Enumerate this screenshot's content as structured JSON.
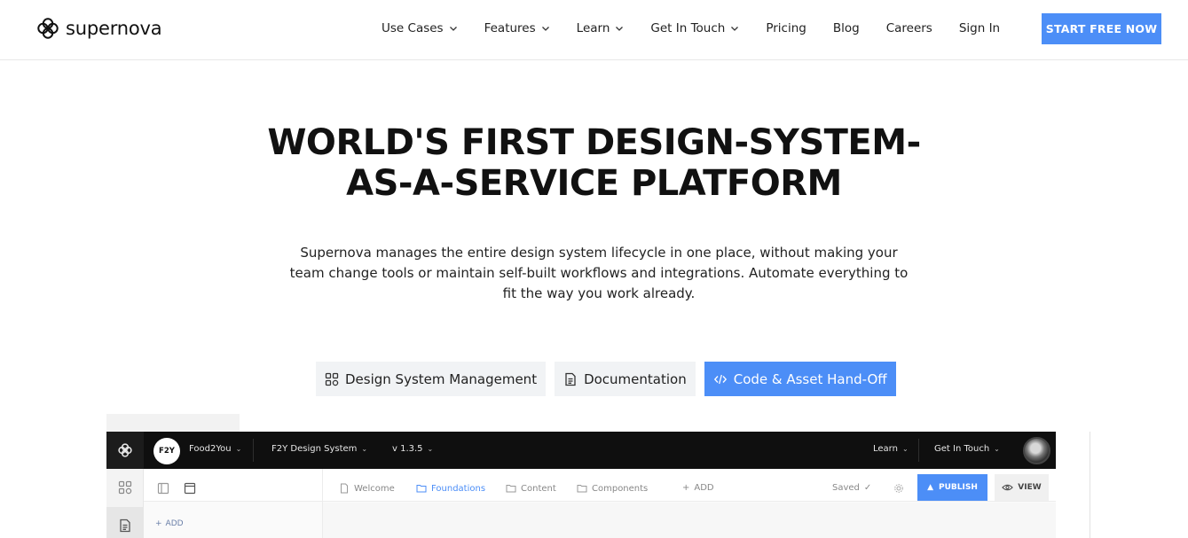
{
  "brand": {
    "name": "supernova",
    "accent": "#4c8ef7"
  },
  "nav": {
    "items": [
      {
        "label": "Use Cases",
        "dropdown": true
      },
      {
        "label": "Features",
        "dropdown": true
      },
      {
        "label": "Learn",
        "dropdown": true
      },
      {
        "label": "Get In Touch",
        "dropdown": true
      },
      {
        "label": "Pricing",
        "dropdown": false
      },
      {
        "label": "Blog",
        "dropdown": false
      },
      {
        "label": "Careers",
        "dropdown": false
      },
      {
        "label": "Sign In",
        "dropdown": false
      }
    ],
    "cta": "START FREE NOW"
  },
  "hero": {
    "title_line1": "WORLD'S FIRST DESIGN-SYSTEM-",
    "title_line2": "AS-A-SERVICE PLATFORM",
    "subtitle": "Supernova manages the entire design system lifecycle in one place, without making your team change tools or maintain self-built workflows and integrations. Automate everything to fit the way you work already."
  },
  "tabs": [
    {
      "label": "Design System Management",
      "icon": "grid-icon",
      "active": false
    },
    {
      "label": "Documentation",
      "icon": "document-icon",
      "active": false
    },
    {
      "label": "Code & Asset Hand-Off",
      "icon": "code-icon",
      "active": true
    }
  ],
  "app_preview": {
    "workspace_badge": "F2Y",
    "workspace": "Food2You",
    "design_system": "F2Y Design System",
    "version": "v 1.3.5",
    "top_right": {
      "learn": "Learn",
      "get_in_touch": "Get In Touch"
    },
    "subnav": {
      "welcome": "Welcome",
      "foundations": "Foundations",
      "content": "Content",
      "components": "Components",
      "add": "ADD"
    },
    "saved": "Saved",
    "publish": "PUBLISH",
    "view": "VIEW",
    "sidebar_add": "ADD"
  }
}
